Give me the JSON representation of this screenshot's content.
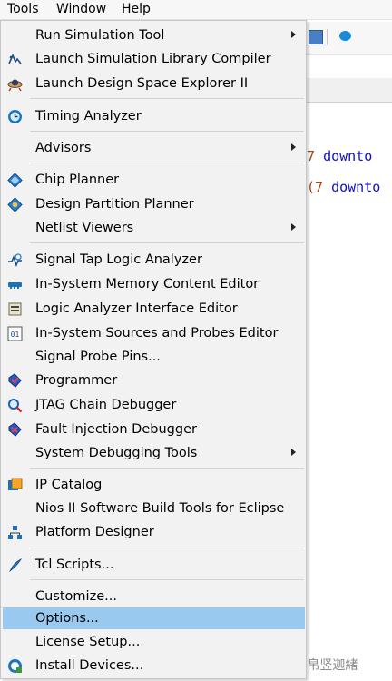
{
  "menubar": {
    "items": [
      "Tools",
      "Window",
      "Help"
    ]
  },
  "background": {
    "code_line1": {
      "prefix": "7 ",
      "keyword": "downto"
    },
    "code_line2": {
      "prefix": "(7 ",
      "keyword": "downto"
    },
    "watermark": "CSDN @帛竖迦緒"
  },
  "tools_menu": {
    "items": [
      {
        "label": "Run Simulation Tool",
        "icon": "none",
        "submenu": true
      },
      {
        "label": "Launch Simulation Library Compiler",
        "icon": "simulation-library-icon",
        "submenu": false
      },
      {
        "label": "Launch Design Space Explorer II",
        "icon": "design-space-explorer-icon",
        "submenu": false
      },
      {
        "label": "Timing Analyzer",
        "icon": "clock-icon",
        "submenu": false
      },
      {
        "label": "Advisors",
        "icon": "none",
        "submenu": true
      },
      {
        "label": "Chip Planner",
        "icon": "chip-planner-icon",
        "submenu": false
      },
      {
        "label": "Design Partition Planner",
        "icon": "design-partition-icon",
        "submenu": false
      },
      {
        "label": "Netlist Viewers",
        "icon": "none",
        "submenu": true
      },
      {
        "label": "Signal Tap Logic Analyzer",
        "icon": "signal-tap-icon",
        "submenu": false
      },
      {
        "label": "In-System Memory Content Editor",
        "icon": "memory-editor-icon",
        "submenu": false
      },
      {
        "label": "Logic Analyzer Interface Editor",
        "icon": "logic-analyzer-interface-icon",
        "submenu": false
      },
      {
        "label": "In-System Sources and Probes Editor",
        "icon": "sources-probes-icon",
        "submenu": false
      },
      {
        "label": "Signal Probe Pins...",
        "icon": "none",
        "submenu": false
      },
      {
        "label": "Programmer",
        "icon": "programmer-icon",
        "submenu": false
      },
      {
        "label": "JTAG Chain Debugger",
        "icon": "jtag-debugger-icon",
        "submenu": false
      },
      {
        "label": "Fault Injection Debugger",
        "icon": "fault-injection-icon",
        "submenu": false
      },
      {
        "label": "System Debugging Tools",
        "icon": "none",
        "submenu": true
      },
      {
        "label": "IP Catalog",
        "icon": "ip-catalog-icon",
        "submenu": false
      },
      {
        "label": "Nios II Software Build Tools for Eclipse",
        "icon": "none",
        "submenu": false
      },
      {
        "label": "Platform Designer",
        "icon": "platform-designer-icon",
        "submenu": false
      },
      {
        "label": "Tcl Scripts...",
        "icon": "tcl-scripts-icon",
        "submenu": false
      },
      {
        "label": "Customize...",
        "icon": "none",
        "submenu": false
      },
      {
        "label": "Options...",
        "icon": "none",
        "submenu": false,
        "highlighted": true
      },
      {
        "label": "License Setup...",
        "icon": "none",
        "submenu": false
      },
      {
        "label": "Install Devices...",
        "icon": "install-devices-icon",
        "submenu": false
      }
    ]
  },
  "colors": {
    "highlight": "#99c9ef",
    "menu_bg": "#f2f2f2",
    "keyword": "#1010c8",
    "number": "#b04010"
  }
}
